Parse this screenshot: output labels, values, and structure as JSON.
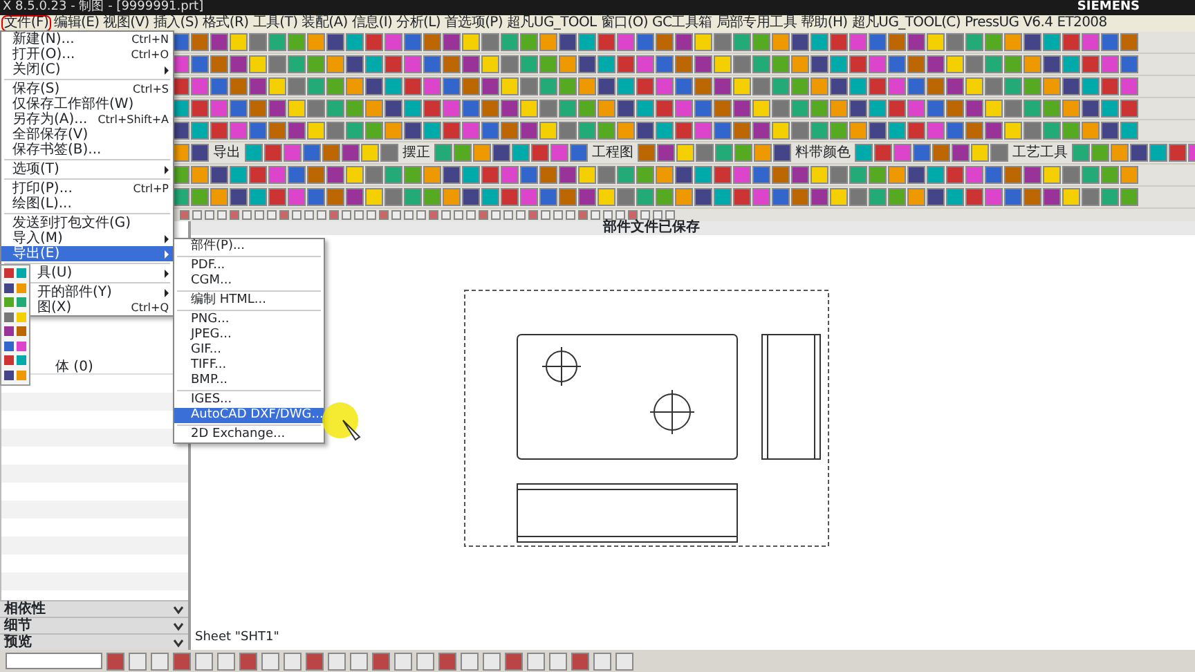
{
  "window": {
    "title": "X 8.5.0.23 - 制图 - [9999991.prt]",
    "brand": "SIEMENS"
  },
  "menu_bar": [
    {
      "label": "文件(F)",
      "selected": true
    },
    {
      "label": "编辑(E)",
      "selected": false
    },
    {
      "label": "视图(V)",
      "selected": false
    },
    {
      "label": "插入(S)",
      "selected": false
    },
    {
      "label": "格式(R)",
      "selected": false
    },
    {
      "label": "工具(T)",
      "selected": false
    },
    {
      "label": "装配(A)",
      "selected": false
    },
    {
      "label": "信息(I)",
      "selected": false
    },
    {
      "label": "分析(L)",
      "selected": false
    },
    {
      "label": "首选项(P)",
      "selected": false
    },
    {
      "label": "超凡UG_TOOL",
      "selected": false
    },
    {
      "label": "窗口(O)",
      "selected": false
    },
    {
      "label": "GC工具箱",
      "selected": false
    },
    {
      "label": "局部专用工具",
      "selected": false
    },
    {
      "label": "帮助(H)",
      "selected": false
    },
    {
      "label": "超凡UG_TOOL(C)",
      "selected": false
    },
    {
      "label": "PressUG V6.4",
      "selected": false
    },
    {
      "label": "ET2008",
      "selected": false
    }
  ],
  "toolbar_labels": [
    "导出",
    "摆正",
    "工程图",
    "料带颜色",
    "工艺工具"
  ],
  "status_message": "部件文件已保存",
  "file_menu": [
    {
      "kind": "item",
      "label": "新建(N)...",
      "shortcut": "Ctrl+N",
      "submenu": false,
      "selected": false
    },
    {
      "kind": "item",
      "label": "打开(O)...",
      "shortcut": "Ctrl+O",
      "submenu": false,
      "selected": false
    },
    {
      "kind": "item",
      "label": "关闭(C)",
      "submenu": true,
      "selected": false
    },
    {
      "kind": "separator"
    },
    {
      "kind": "item",
      "label": "保存(S)",
      "shortcut": "Ctrl+S",
      "submenu": false,
      "selected": false
    },
    {
      "kind": "item",
      "label": "仅保存工作部件(W)",
      "submenu": false,
      "selected": false
    },
    {
      "kind": "item",
      "label": "另存为(A)...",
      "shortcut": "Ctrl+Shift+A",
      "submenu": false,
      "selected": false
    },
    {
      "kind": "item",
      "label": "全部保存(V)",
      "submenu": false,
      "selected": false
    },
    {
      "kind": "item",
      "label": "保存书签(B)...",
      "submenu": false,
      "selected": false
    },
    {
      "kind": "separator"
    },
    {
      "kind": "item",
      "label": "选项(T)",
      "submenu": true,
      "selected": false
    },
    {
      "kind": "separator"
    },
    {
      "kind": "item",
      "label": "打印(P)...",
      "shortcut": "Ctrl+P",
      "submenu": false,
      "selected": false
    },
    {
      "kind": "item",
      "label": "绘图(L)...",
      "submenu": false,
      "selected": false
    },
    {
      "kind": "separator"
    },
    {
      "kind": "item",
      "label": "发送到打包文件(G)",
      "submenu": false,
      "selected": false
    },
    {
      "kind": "item",
      "label": "导入(M)",
      "submenu": true,
      "selected": false
    },
    {
      "kind": "item",
      "label": "导出(E)",
      "submenu": true,
      "selected": true
    },
    {
      "kind": "separator"
    },
    {
      "kind": "covered",
      "label": "具(U)",
      "submenu": true,
      "selected": false
    },
    {
      "kind": "separator"
    },
    {
      "kind": "covered",
      "label": "开的部件(Y)",
      "submenu": true,
      "selected": false
    },
    {
      "kind": "covered",
      "label": "图(X)",
      "shortcut": "Ctrl+Q",
      "submenu": false,
      "selected": false
    }
  ],
  "export_menu": [
    {
      "kind": "item",
      "label": "部件(P)...",
      "selected": false
    },
    {
      "kind": "separator"
    },
    {
      "kind": "item",
      "label": "PDF...",
      "selected": false
    },
    {
      "kind": "item",
      "label": "CGM...",
      "selected": false
    },
    {
      "kind": "separator"
    },
    {
      "kind": "item",
      "label": "编制 HTML...",
      "selected": false
    },
    {
      "kind": "separator"
    },
    {
      "kind": "item",
      "label": "PNG...",
      "selected": false
    },
    {
      "kind": "item",
      "label": "JPEG...",
      "selected": false
    },
    {
      "kind": "item",
      "label": "GIF...",
      "selected": false
    },
    {
      "kind": "item",
      "label": "TIFF...",
      "selected": false
    },
    {
      "kind": "item",
      "label": "BMP...",
      "selected": false
    },
    {
      "kind": "separator"
    },
    {
      "kind": "item",
      "label": "IGES...",
      "selected": false
    },
    {
      "kind": "item",
      "label": "AutoCAD DXF/DWG...",
      "selected": true
    },
    {
      "kind": "separator"
    },
    {
      "kind": "item",
      "label": "2D Exchange...",
      "selected": false
    }
  ],
  "navigator": {
    "row": "体 (0)",
    "sections": [
      {
        "label": "相依性",
        "expanded": false
      },
      {
        "label": "细节",
        "expanded": false
      },
      {
        "label": "预览",
        "expanded": false
      }
    ]
  },
  "sheet_label": "Sheet \"SHT1\""
}
